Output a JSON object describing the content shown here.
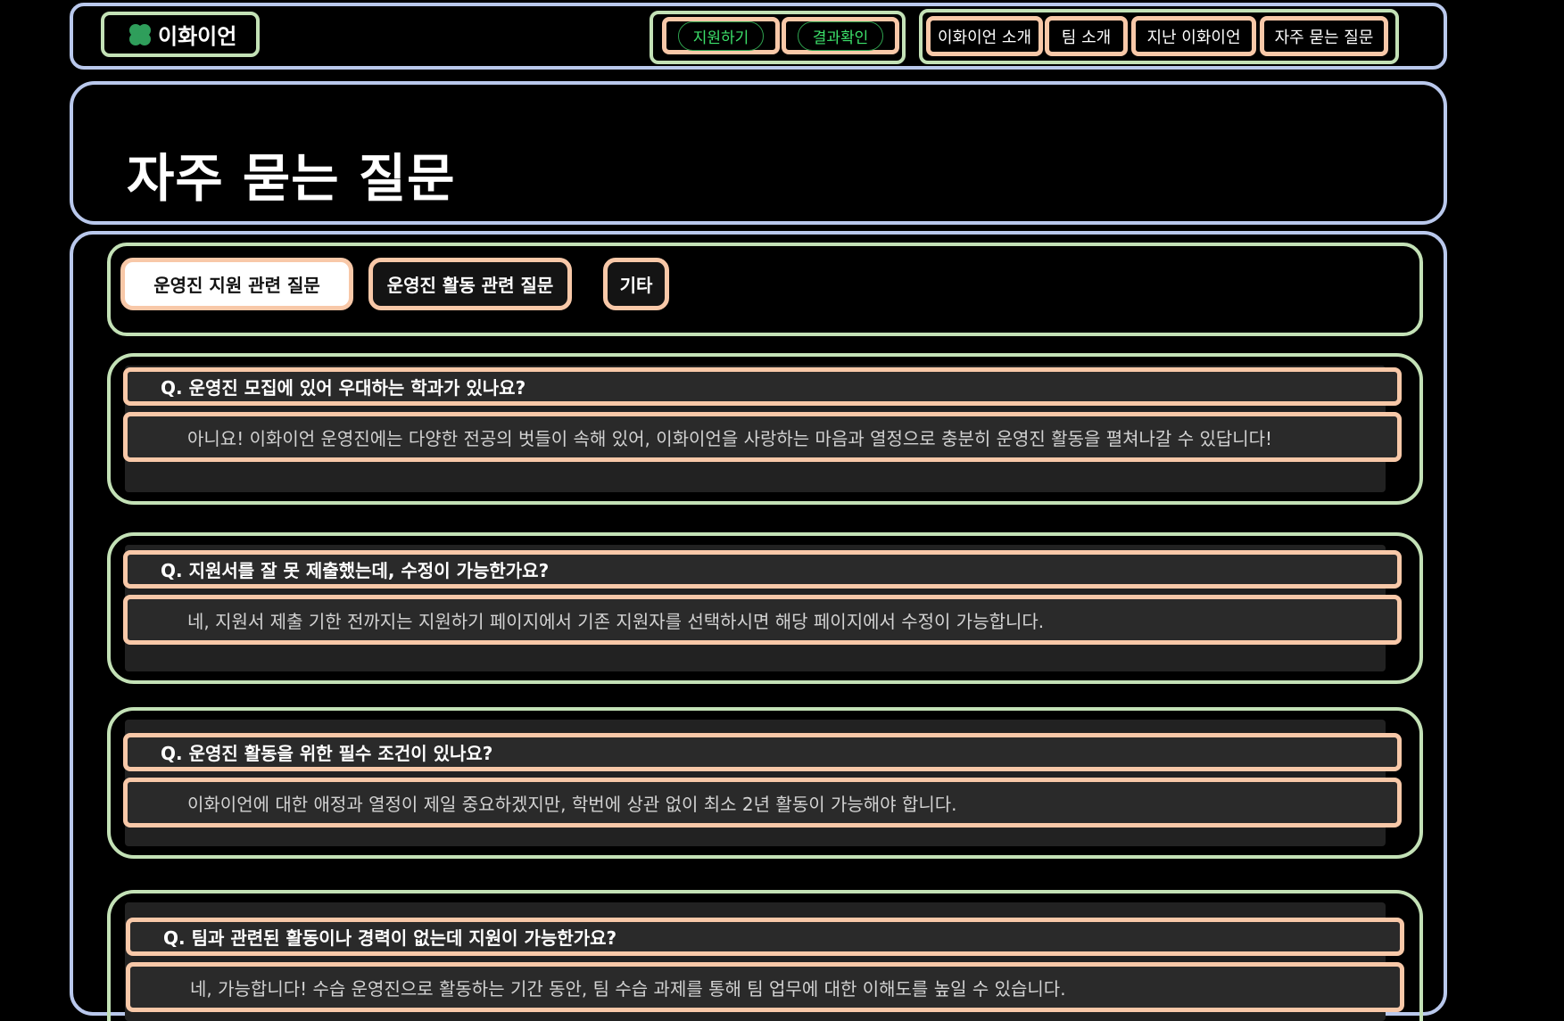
{
  "header": {
    "logo_text": "이화이언",
    "cta": [
      "지원하기",
      "결과확인"
    ],
    "nav": [
      "이화이언 소개",
      "팀 소개",
      "지난 이화이언",
      "자주 묻는 질문"
    ]
  },
  "page_title": "자주 묻는 질문",
  "tabs": [
    {
      "label": "운영진 지원 관련 질문",
      "active": true
    },
    {
      "label": "운영진 활동 관련 질문",
      "active": false
    },
    {
      "label": "기타",
      "active": false
    }
  ],
  "faqs": [
    {
      "q": "Q. 운영진 모집에 있어 우대하는 학과가 있나요?",
      "a": "아니요! 이화이언 운영진에는 다양한 전공의 벗들이 속해 있어, 이화이언을 사랑하는 마음과 열정으로 충분히 운영진 활동을 펼쳐나갈 수 있답니다!"
    },
    {
      "q": "Q. 지원서를 잘 못 제출했는데, 수정이 가능한가요?",
      "a": "네, 지원서 제출 기한 전까지는 지원하기 페이지에서 기존 지원자를 선택하시면 해당 페이지에서 수정이 가능합니다."
    },
    {
      "q": "Q. 운영진 활동을 위한 필수 조건이 있나요?",
      "a": "이화이언에 대한 애정과 열정이 제일 중요하겠지만, 학번에 상관 없이 최소 2년 활동이 가능해야 합니다."
    },
    {
      "q": "Q. 팀과 관련된 활동이나 경력이 없는데 지원이 가능한가요?",
      "a": "네, 가능합니다! 수습 운영진으로 활동하는 기간 동안, 팀 수습 과제를 통해 팀 업무에 대한 이해도를 높일 수 있습니다."
    }
  ],
  "colors": {
    "brand_green": "#2f9e5b",
    "cta_text": "#3ce06a",
    "outline_blue": "#b9c8ec",
    "outline_green": "#c3e1b6",
    "outline_peach": "#f8c8a8"
  }
}
